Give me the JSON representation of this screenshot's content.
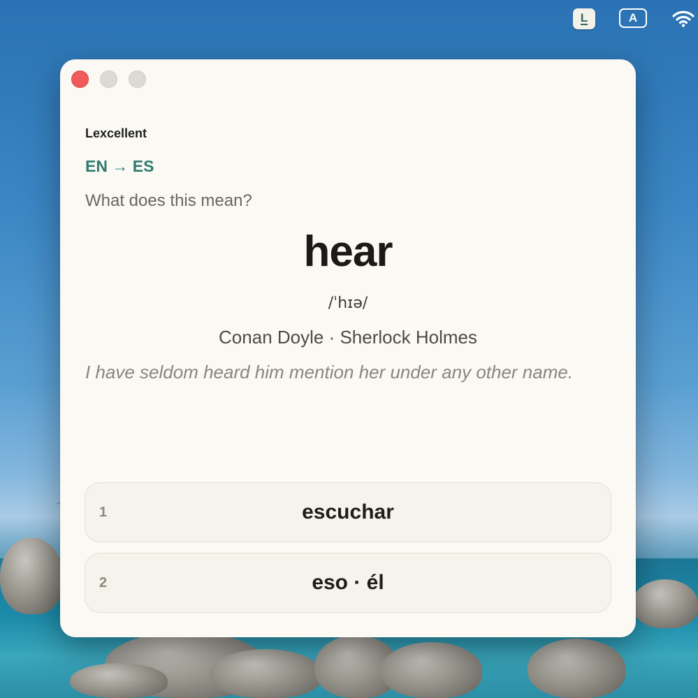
{
  "menubar": {
    "app_icon_letter": "L",
    "input_source_letter": "A"
  },
  "window": {
    "app_name": "Lexcellent",
    "language_pair": "EN → ES",
    "prompt": "What does this mean?",
    "headword": "hear",
    "ipa": "/ˈhɪə/",
    "source": "Conan Doyle · Sherlock Holmes",
    "example": "I have seldom heard him mention her under any other name.",
    "options": [
      {
        "number": "1",
        "label": "escuchar"
      },
      {
        "number": "2",
        "label": "eso · él"
      }
    ]
  },
  "colors": {
    "accent": "#2f7a70",
    "close_button": "#f15a5a",
    "window_bg": "#fbf9f4"
  }
}
